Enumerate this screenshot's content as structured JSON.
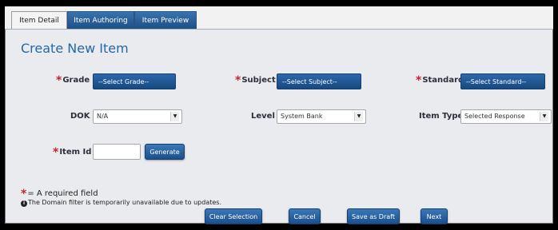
{
  "tabs": [
    {
      "label": "Item Detail",
      "active": true
    },
    {
      "label": "Item Authoring",
      "active": false
    },
    {
      "label": "Item Preview",
      "active": false
    }
  ],
  "page_title": "Create New Item",
  "required_marker": "*",
  "fields": {
    "grade": {
      "label": "Grade",
      "value": "--Select Grade--"
    },
    "subject": {
      "label": "Subject",
      "value": "--Select Subject--"
    },
    "standard": {
      "label": "Standard",
      "value": "--Select Standard--"
    },
    "dok": {
      "label": "DOK",
      "value": "N/A"
    },
    "level": {
      "label": "Level",
      "value": "System Bank"
    },
    "item_type": {
      "label": "Item Type",
      "value": "Selected Response"
    },
    "item_id": {
      "label": "Item Id",
      "value": ""
    }
  },
  "dropdown_arrow": "▼",
  "generate_label": "Generate",
  "notes": {
    "required": "= A required field",
    "info_icon_glyph": "i",
    "domain": "The Domain filter is temporarily unavailable due to updates."
  },
  "buttons": {
    "clear": "Clear Selection",
    "cancel": "Cancel",
    "save_draft": "Save as Draft",
    "next": "Next"
  },
  "colors": {
    "accent_blue": "#1d4f86",
    "required_red": "#c8202e",
    "title_blue": "#2468a8"
  }
}
